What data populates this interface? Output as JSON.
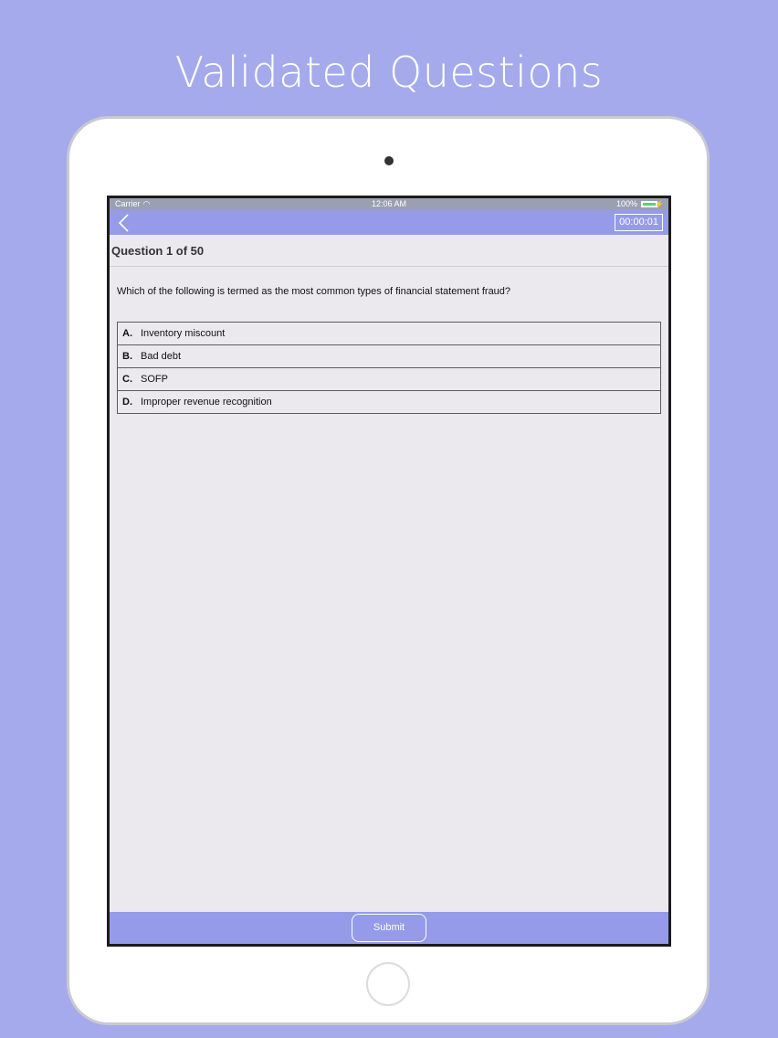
{
  "headline": "Validated Questions",
  "status_bar": {
    "carrier": "Carrier",
    "time": "12:06 AM",
    "battery": "100%"
  },
  "nav": {
    "timer": "00:00:01"
  },
  "question": {
    "counter": "Question 1 of 50",
    "text": "Which of the following is termed as the most common types of financial statement fraud?",
    "options": [
      {
        "letter": "A.",
        "text": "Inventory miscount"
      },
      {
        "letter": "B.",
        "text": "Bad debt"
      },
      {
        "letter": "C.",
        "text": "SOFP"
      },
      {
        "letter": "D.",
        "text": "Improper revenue recognition"
      }
    ]
  },
  "footer": {
    "submit_label": "Submit"
  },
  "colors": {
    "background": "#a5aaec",
    "nav_bar": "#959be8",
    "content_bg": "#ebe9ee"
  }
}
